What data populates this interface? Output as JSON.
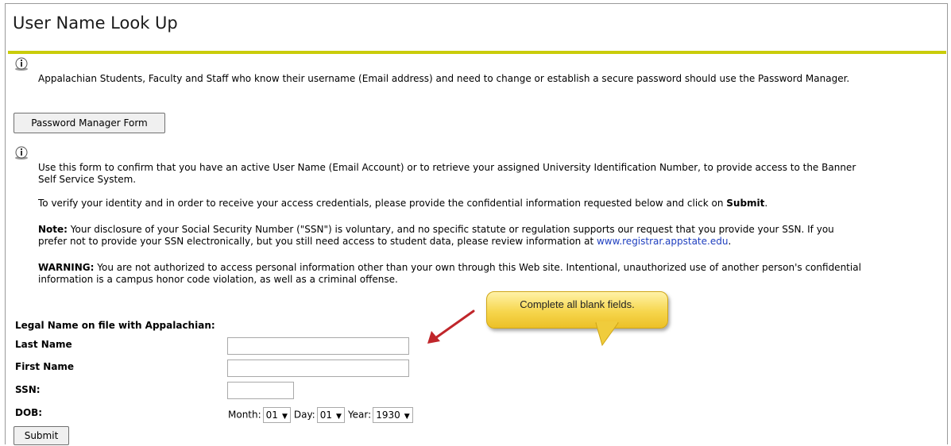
{
  "header": {
    "title": "User Name Look Up"
  },
  "info1": {
    "text": "Appalachian Students, Faculty and Staff who know their username (Email address) and need to change or establish a secure password should use the Password Manager."
  },
  "password_manager_button": "Password Manager Form",
  "info2": {
    "line1": "Use this form to confirm that you have an active User Name (Email Account) or to retrieve your assigned University Identification Number, to provide access to the Banner",
    "line2": "Self Service System.",
    "verify_text": "To verify your identity and in order to receive your access credentials, please provide the confidential information requested below and click on ",
    "verify_bold": "Submit",
    "verify_end": ".",
    "note_label": "Note:",
    "note_line1": " Your disclosure of your Social Security Number (\"SSN\") is voluntary, and no specific statute or regulation supports our request that you provide your SSN. If you",
    "note_line2": "prefer not to provide your SSN electronically, but you still need access to student data, please review information at ",
    "note_link": "www.registrar.appstate.edu",
    "note_end": ".",
    "warning_label": "WARNING:",
    "warning_line1": " You are not authorized to access personal information other than your own through this Web site. Intentional, unauthorized use of another person's confidential",
    "warning_line2": "information is a campus honor code violation, as well as a criminal offense."
  },
  "callout": {
    "text": "Complete all blank fields."
  },
  "form": {
    "section_label": "Legal Name on file with Appalachian:",
    "last_name_label": "Last Name",
    "last_name_value": "",
    "first_name_label": "First Name",
    "first_name_value": "",
    "ssn_label": "SSN:",
    "ssn_value": "",
    "dob_label": "DOB:",
    "month_label": "Month:",
    "month_value": "01",
    "day_label": "Day:",
    "day_value": "01",
    "year_label": "Year:",
    "year_value": "1930",
    "submit_label": "Submit"
  },
  "colors": {
    "rule": "#c9cc0a",
    "link": "#1f3fbf",
    "callout_fill": "#f6d64d",
    "arrow": "#c0262b"
  },
  "icons": {
    "info": "info-icon",
    "arrow": "arrow-icon"
  }
}
